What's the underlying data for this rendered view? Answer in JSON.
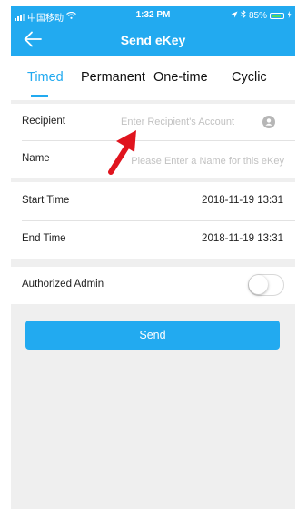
{
  "status_bar": {
    "carrier": "中国移动",
    "time": "1:32 PM",
    "battery": "85%",
    "battery_level": 0.85
  },
  "nav": {
    "title": "Send eKey"
  },
  "tabs": [
    {
      "label": "Timed",
      "active": true
    },
    {
      "label": "Permanent",
      "active": false
    },
    {
      "label": "One-time",
      "active": false
    },
    {
      "label": "Cyclic",
      "active": false
    }
  ],
  "form": {
    "recipient": {
      "label": "Recipient",
      "placeholder": "Enter Recipient's Account",
      "value": ""
    },
    "name": {
      "label": "Name",
      "placeholder": "Please Enter a Name for this eKey",
      "value": ""
    },
    "start_time": {
      "label": "Start Time",
      "value": "2018-11-19 13:31"
    },
    "end_time": {
      "label": "End Time",
      "value": "2018-11-19 13:31"
    },
    "authorized_admin": {
      "label": "Authorized Admin",
      "enabled": false
    }
  },
  "send_button": {
    "label": "Send"
  },
  "colors": {
    "accent": "#22aaf0",
    "annotation": "#e0141e"
  }
}
